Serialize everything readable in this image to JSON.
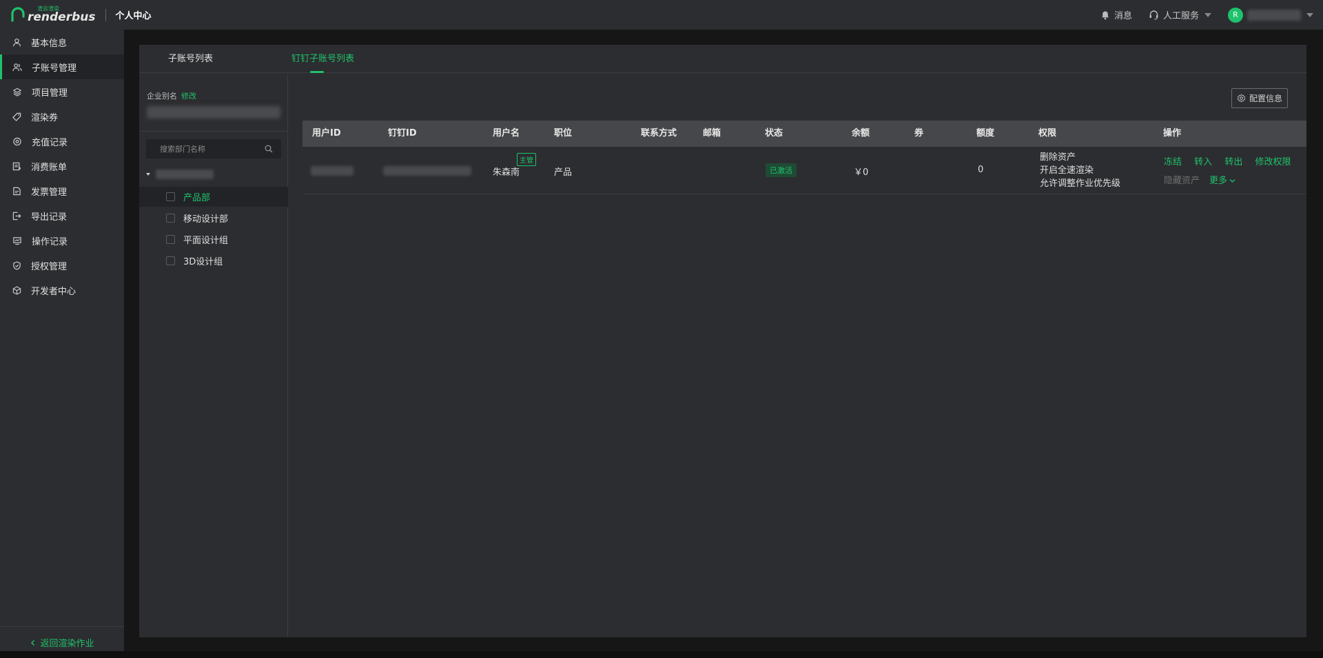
{
  "header": {
    "logo_small": "渲云渲染",
    "logo_text": "renderbus",
    "title": "个人中心",
    "messages": "消息",
    "service": "人工服务",
    "avatar_letter": "R"
  },
  "sidebar": {
    "items": [
      {
        "label": "基本信息",
        "icon": "user-icon"
      },
      {
        "label": "子账号管理",
        "icon": "users-icon"
      },
      {
        "label": "项目管理",
        "icon": "layers-icon"
      },
      {
        "label": "渲染券",
        "icon": "tag-icon"
      },
      {
        "label": "充值记录",
        "icon": "eye-icon"
      },
      {
        "label": "消费账单",
        "icon": "bill-icon"
      },
      {
        "label": "发票管理",
        "icon": "invoice-icon"
      },
      {
        "label": "导出记录",
        "icon": "export-icon"
      },
      {
        "label": "操作记录",
        "icon": "monitor-icon"
      },
      {
        "label": "授权管理",
        "icon": "shield-icon"
      },
      {
        "label": "开发者中心",
        "icon": "cube-icon"
      }
    ],
    "back_label": "返回渲染作业"
  },
  "tabs": {
    "sub_accounts": "子账号列表",
    "dingtalk_sub_accounts": "钉钉子账号列表"
  },
  "left_panel": {
    "company_alias_label": "企业别名",
    "edit_label": "修改",
    "search_placeholder": "搜索部门名称",
    "departments": [
      "产品部",
      "移动设计部",
      "平面设计组",
      "3D设计组"
    ]
  },
  "toolbar": {
    "config_label": "配置信息"
  },
  "table": {
    "headers": [
      "用户ID",
      "钉钉ID",
      "用户名",
      "职位",
      "联系方式",
      "邮箱",
      "状态",
      "余额",
      "券",
      "额度",
      "权限",
      "操作"
    ],
    "rows": [
      {
        "username": "朱森南",
        "badge": "主管",
        "position": "产品",
        "status": "已激活",
        "balance": "￥0",
        "quota": "0",
        "permissions": [
          "删除资产",
          "开启全速渲染",
          "允许调整作业优先级"
        ],
        "ops": {
          "freeze": "冻结",
          "transfer_in": "转入",
          "transfer_out": "转出",
          "edit_permissions": "修改权限",
          "hide_assets": "隐藏资产",
          "more": "更多"
        }
      }
    ]
  },
  "colors": {
    "accent": "#1fc26c",
    "panel": "#2c2d30",
    "background": "#161616"
  }
}
